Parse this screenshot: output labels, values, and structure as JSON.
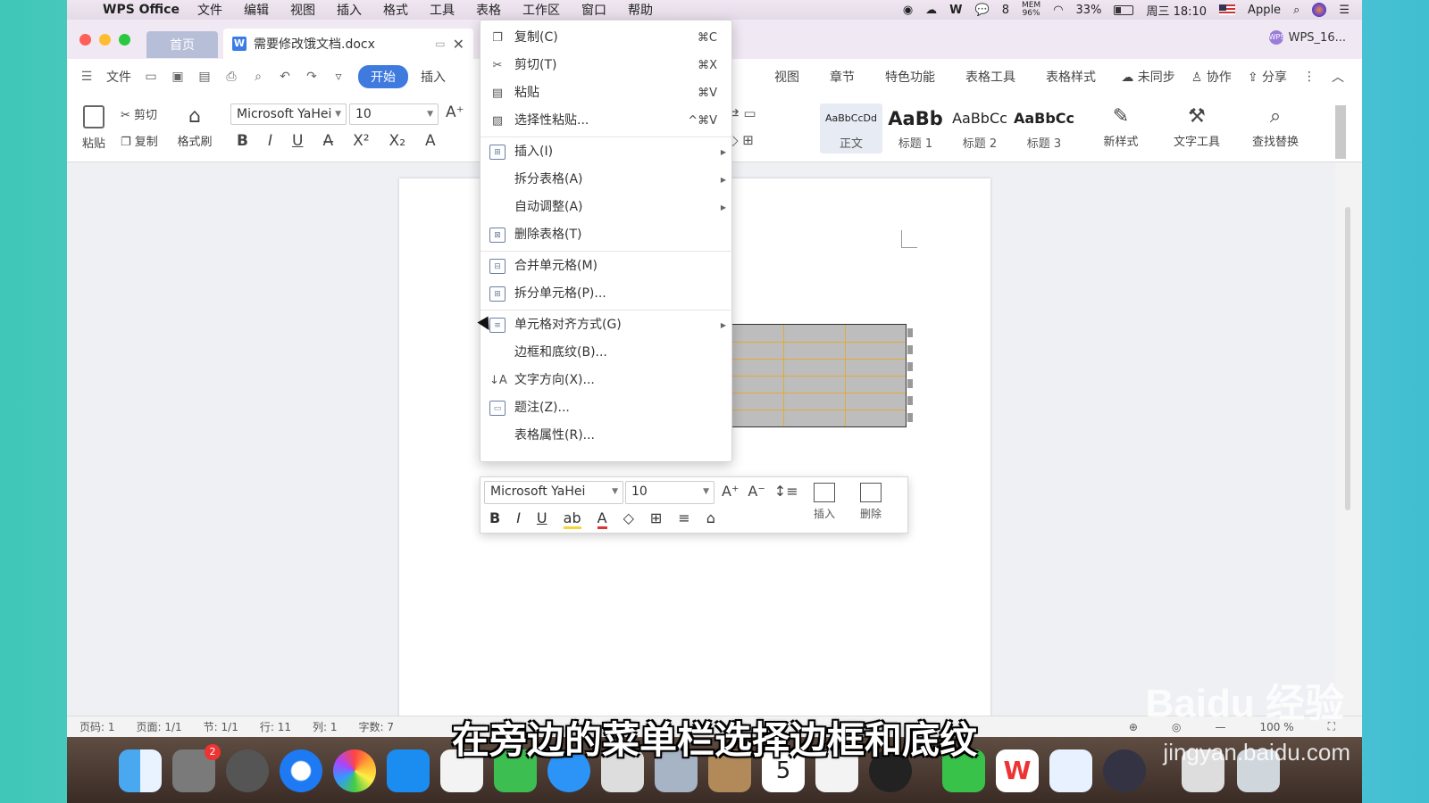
{
  "menubar": {
    "app_name": "WPS Office",
    "items": [
      "文件",
      "编辑",
      "视图",
      "插入",
      "格式",
      "工具",
      "表格",
      "工作区",
      "窗口",
      "帮助"
    ],
    "wechat_count": "8",
    "mem_label": "MEM",
    "mem_value": "96%",
    "battery": "33%",
    "clock": "周三 18:10",
    "user": "Apple"
  },
  "titlebar": {
    "home_tab": "首页",
    "doc_tab": "需要修改饿文档.docx",
    "account": "WPS_16..."
  },
  "ribbon_tabs": {
    "file": "文件",
    "start": "开始",
    "insert": "插入",
    "right_tabs": [
      "视图",
      "章节",
      "特色功能",
      "表格工具",
      "表格样式"
    ],
    "sync": "未同步",
    "collab": "协作",
    "share": "分享"
  },
  "ribbon": {
    "paste": "粘贴",
    "cut": "剪切",
    "copy": "复制",
    "format_painter": "格式刷",
    "font": "Microsoft YaHei",
    "size": "10",
    "styles": [
      {
        "sample": "AaBbCcDd",
        "caption": "正文"
      },
      {
        "sample": "AaBb",
        "caption": "标题 1"
      },
      {
        "sample": "AaBbCc",
        "caption": "标题 2"
      },
      {
        "sample": "AaBbCc",
        "caption": "标题 3"
      }
    ],
    "new_style": "新样式",
    "text_tools": "文字工具",
    "find_replace": "查找替换"
  },
  "context_menu": {
    "items": [
      {
        "icon": "copy-icon",
        "label": "复制(C)",
        "shortcut": "⌘C"
      },
      {
        "icon": "scissors-icon",
        "label": "剪切(T)",
        "shortcut": "⌘X"
      },
      {
        "icon": "paste-icon",
        "label": "粘贴",
        "shortcut": "⌘V"
      },
      {
        "icon": "paste-special-icon",
        "label": "选择性粘贴...",
        "shortcut": "^⌘V"
      },
      {
        "icon": "table-insert-icon",
        "label": "插入(I)",
        "submenu": true
      },
      {
        "icon": "",
        "label": "拆分表格(A)",
        "submenu": true
      },
      {
        "icon": "",
        "label": "自动调整(A)",
        "submenu": true
      },
      {
        "icon": "table-delete-icon",
        "label": "删除表格(T)"
      },
      {
        "icon": "merge-cells-icon",
        "label": "合并单元格(M)"
      },
      {
        "icon": "split-cells-icon",
        "label": "拆分单元格(P)..."
      },
      {
        "icon": "cell-align-icon",
        "label": "单元格对齐方式(G)",
        "submenu": true
      },
      {
        "icon": "",
        "label": "边框和底纹(B)..."
      },
      {
        "icon": "text-direction-icon",
        "label": "文字方向(X)..."
      },
      {
        "icon": "caption-icon",
        "label": "题注(Z)..."
      },
      {
        "icon": "",
        "label": "表格属性(R)..."
      }
    ]
  },
  "mini_toolbar": {
    "font": "Microsoft YaHei",
    "size": "10",
    "insert": "插入",
    "delete": "删除"
  },
  "status": {
    "page_code": "页码: 1",
    "page": "页面: 1/1",
    "section": "节: 1/1",
    "row": "行: 11",
    "col": "列: 1",
    "words": "字数: 7",
    "zoom": "100 %"
  },
  "dock": {
    "settings_badge": "2",
    "calendar_day": "5"
  },
  "overlay": {
    "subtitle": "在旁边的菜单栏选择边框和底纹",
    "watermark": "Baidu 经验",
    "watermark_url": "jingyan.baidu.com"
  },
  "colors": {
    "accent": "#3f7bdf",
    "table_fill": "#bdbdbd",
    "table_line": "#e3a93a"
  }
}
